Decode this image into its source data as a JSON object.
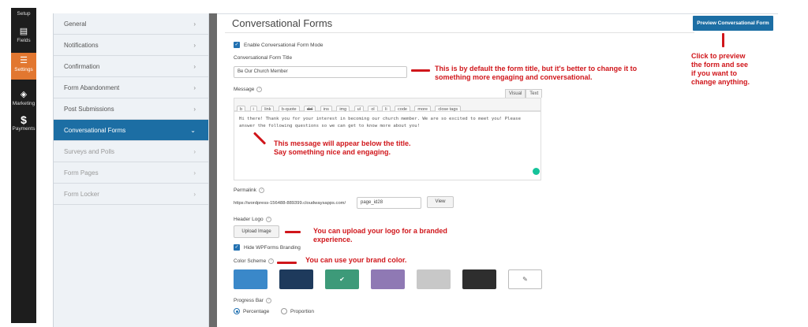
{
  "leftnav": {
    "items": [
      {
        "label": "Setup",
        "icon": "setup-icon"
      },
      {
        "label": "Fields",
        "icon": "fields-icon"
      },
      {
        "label": "Settings",
        "icon": "sliders-icon"
      },
      {
        "label": "Marketing",
        "icon": "megaphone-icon"
      },
      {
        "label": "Payments",
        "icon": "dollar-icon"
      }
    ]
  },
  "sidebar": {
    "items": [
      {
        "label": "General"
      },
      {
        "label": "Notifications"
      },
      {
        "label": "Confirmation"
      },
      {
        "label": "Form Abandonment"
      },
      {
        "label": "Post Submissions"
      },
      {
        "label": "Conversational Forms"
      },
      {
        "label": "Surveys and Polls"
      },
      {
        "label": "Form Pages"
      },
      {
        "label": "Form Locker"
      }
    ]
  },
  "main": {
    "title": "Conversational Forms",
    "preview_button": "Preview Conversational Form",
    "enable_label": "Enable Conversational Form Mode",
    "form_title_label": "Conversational Form Title",
    "form_title_value": "Be Our Church Member",
    "message_label": "Message",
    "editor_tab_visual": "Visual",
    "editor_tab_text": "Text",
    "quicktags": [
      "b",
      "i",
      "link",
      "b-quote",
      "del",
      "ins",
      "img",
      "ul",
      "ol",
      "li",
      "code",
      "more",
      "close tags"
    ],
    "message_text": "Hi there! Thank you for your interest in becoming our church member. We are so excited to meet you! Please answer the following questions so we can get to know more about you!",
    "permalink_label": "Permalink",
    "permalink_base": "https://wordpress-156488-889399.cloudwaysapps.com/",
    "permalink_slug": "page_id28",
    "view_button": "View",
    "header_logo_label": "Header Logo",
    "upload_button": "Upload Image",
    "hide_branding_label": "Hide WPForms Branding",
    "color_scheme_label": "Color Scheme",
    "swatches": [
      "#3a88c9",
      "#1e3a5c",
      "#3d9a79",
      "#8f79b4",
      "#c8c8c8",
      "#2e2e2e"
    ],
    "progress_bar_label": "Progress Bar",
    "progress_percentage": "Percentage",
    "progress_proportion": "Proportion"
  },
  "annotations": {
    "preview_note": "Click to preview the form and see if you want to change anything.",
    "preview_lines": [
      "Click to preview",
      "the form and see",
      "if you want to",
      "change anything."
    ],
    "title_note_1": "This is by default the form title, but it's better to change it to",
    "title_note_2": "something more engaging and conversational.",
    "message_note_1": "This message will appear below the title.",
    "message_note_2": "Say something nice and engaging.",
    "logo_note_1": "You can upload your logo for a branded",
    "logo_note_2": "experience.",
    "color_note": "You can use your brand color."
  },
  "colors": {
    "accent": "#1c6ea4",
    "settings_active": "#e27730",
    "annotation": "#d0161b"
  }
}
